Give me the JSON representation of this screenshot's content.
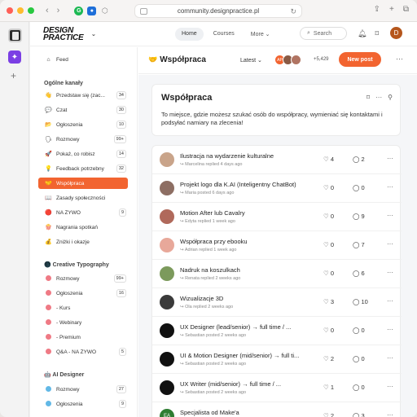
{
  "browser": {
    "url": "community.designpractice.pl"
  },
  "brand": {
    "line1": "DESIGN",
    "line2": "PRACTICE"
  },
  "topnav": {
    "home": "Home",
    "courses": "Courses",
    "more": "More"
  },
  "search": {
    "placeholder": "Search"
  },
  "user": {
    "initial": "D"
  },
  "sidebar": {
    "feed": "Feed",
    "section1": "Ogólne kanały",
    "items": [
      {
        "icon": "👋",
        "label": "Przedstaw się (zac...",
        "count": "34"
      },
      {
        "icon": "💬",
        "label": "Czat",
        "count": "30"
      },
      {
        "icon": "📂",
        "label": "Ogłoszenia",
        "count": "10"
      },
      {
        "icon": "🗣",
        "label": "Rozmowy",
        "count": "99+"
      },
      {
        "icon": "🚀",
        "label": "Pokaż, co robisz",
        "count": "14"
      },
      {
        "icon": "💡",
        "label": "Feedback potrzebny",
        "count": "32"
      },
      {
        "icon": "🤝",
        "label": "Współpraca",
        "count": ""
      },
      {
        "icon": "📖",
        "label": "Zasady społeczności",
        "count": ""
      },
      {
        "icon": "🔴",
        "label": "NA ŻYWO",
        "count": "9"
      },
      {
        "icon": "🍿",
        "label": "Nagrania spotkań",
        "count": ""
      },
      {
        "icon": "💰",
        "label": "Zniżki i okazje",
        "count": ""
      }
    ],
    "section2": "Creative Typography",
    "items2": [
      {
        "label": "Rozmowy",
        "count": "99+"
      },
      {
        "label": "Ogłoszenia",
        "count": "16"
      },
      {
        "label": "- Kurs",
        "count": ""
      },
      {
        "label": "- Webinary",
        "count": ""
      },
      {
        "label": "- Premium",
        "count": ""
      },
      {
        "label": "Q&A - NA ŻYWO",
        "count": "5"
      }
    ],
    "section3": "AI Designer",
    "items3": [
      {
        "label": "Rozmowy",
        "count": "27"
      },
      {
        "label": "Ogłoszenia",
        "count": "9"
      }
    ]
  },
  "channel": {
    "title": "Współpraca",
    "sort": "Latest",
    "member_count": "+5,429",
    "avatars": [
      "AP",
      "",
      ""
    ],
    "new_post": "New post"
  },
  "info_card": {
    "title": "Współpraca",
    "description": "To miejsce, gdzie możesz szukać osób do współpracy, wymieniać się kontaktami i podsyłać namiary na zlecenia!"
  },
  "posts": [
    {
      "title": "Ilustracja na wydarzenie kulturalne",
      "meta": "Marcelina replied 4 days ago",
      "likes": "4",
      "comments": "2",
      "avatar_color": "#c9a48a",
      "avatar_text": ""
    },
    {
      "title": "Projekt logo dla K.AI (Inteligentny ChatBot)",
      "meta": "Maria posted 6 days ago",
      "likes": "0",
      "comments": "0",
      "avatar_color": "#8d6e63",
      "avatar_text": ""
    },
    {
      "title": "Motion After lub Cavalry",
      "meta": "Edyta replied 1 week ago",
      "likes": "0",
      "comments": "9",
      "avatar_color": "#b0695b",
      "avatar_text": ""
    },
    {
      "title": "Współpraca przy ebooku",
      "meta": "Adrian replied 1 week ago",
      "likes": "0",
      "comments": "7",
      "avatar_color": "#e8a89a",
      "avatar_text": ""
    },
    {
      "title": "Nadruk na koszulkach",
      "meta": "Renata replied 2 weeks ago",
      "likes": "0",
      "comments": "6",
      "avatar_color": "#7c9a5c",
      "avatar_text": ""
    },
    {
      "title": "Wizualizacje 3D",
      "meta": "Ola replied 2 weeks ago",
      "likes": "3",
      "comments": "10",
      "avatar_color": "#3a3a3a",
      "avatar_text": ""
    },
    {
      "title": "UX Designer (lead/senior) → full time / ...",
      "meta": "Sebastian posted 2 weeks ago",
      "likes": "0",
      "comments": "0",
      "avatar_color": "#111111",
      "avatar_text": ""
    },
    {
      "title": "UI & Motion Designer (mid/senior) → full ti...",
      "meta": "Sebastian posted 2 weeks ago",
      "likes": "2",
      "comments": "0",
      "avatar_color": "#111111",
      "avatar_text": ""
    },
    {
      "title": "UX Writer (mid/senior) → full time / ...",
      "meta": "Sebastian posted 2 weeks ago",
      "likes": "1",
      "comments": "0",
      "avatar_color": "#111111",
      "avatar_text": ""
    },
    {
      "title": "Specjalista od Make'a",
      "meta": "Sebastian replied 3 weeks ago",
      "likes": "2",
      "comments": "3",
      "avatar_color": "#2e7d32",
      "avatar_text": "EA"
    }
  ],
  "colors": {
    "accent": "#f26430",
    "dot_pink": "#ef7a85",
    "dot_blue": "#62b8e6"
  }
}
